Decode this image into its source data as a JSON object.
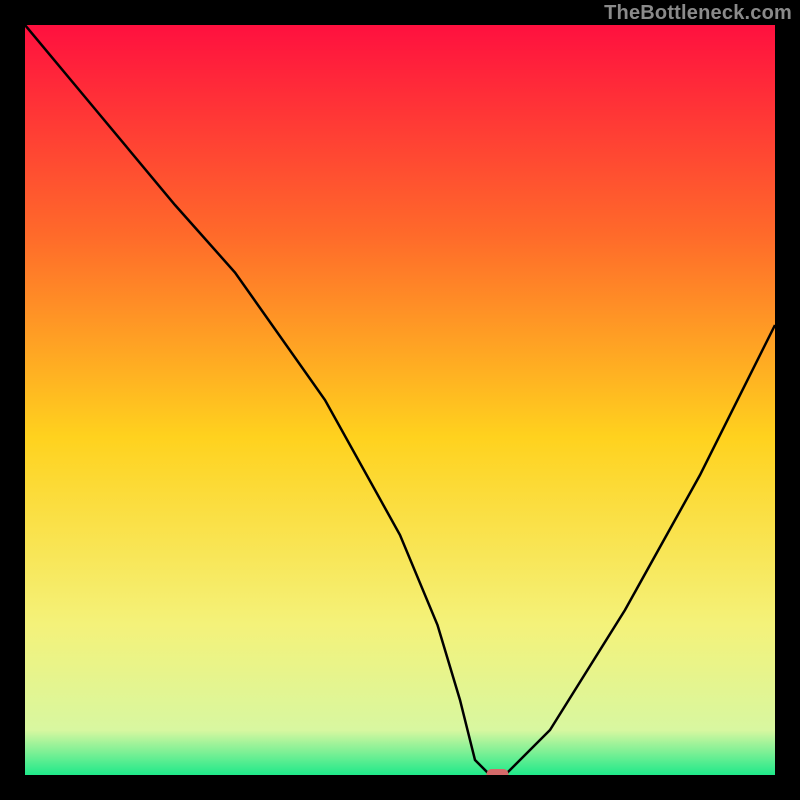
{
  "watermark": "TheBottleneck.com",
  "chart_data": {
    "type": "line",
    "title": "",
    "xlabel": "",
    "ylabel": "",
    "xlim": [
      0,
      100
    ],
    "ylim": [
      0,
      100
    ],
    "x": [
      0,
      10,
      20,
      28,
      40,
      50,
      55,
      58,
      60,
      62,
      64,
      70,
      80,
      90,
      100
    ],
    "values": [
      100,
      88,
      76,
      67,
      50,
      32,
      20,
      10,
      2,
      0,
      0,
      6,
      22,
      40,
      60
    ],
    "marker": {
      "x": 63,
      "y": 0
    },
    "colors": {
      "top": "#ff103f",
      "mid1": "#ff6a2a",
      "mid2": "#ffd21e",
      "mid3": "#f4f27a",
      "bottom": "#1fe98a",
      "curve": "#000000",
      "marker": "#d46a6a"
    }
  }
}
